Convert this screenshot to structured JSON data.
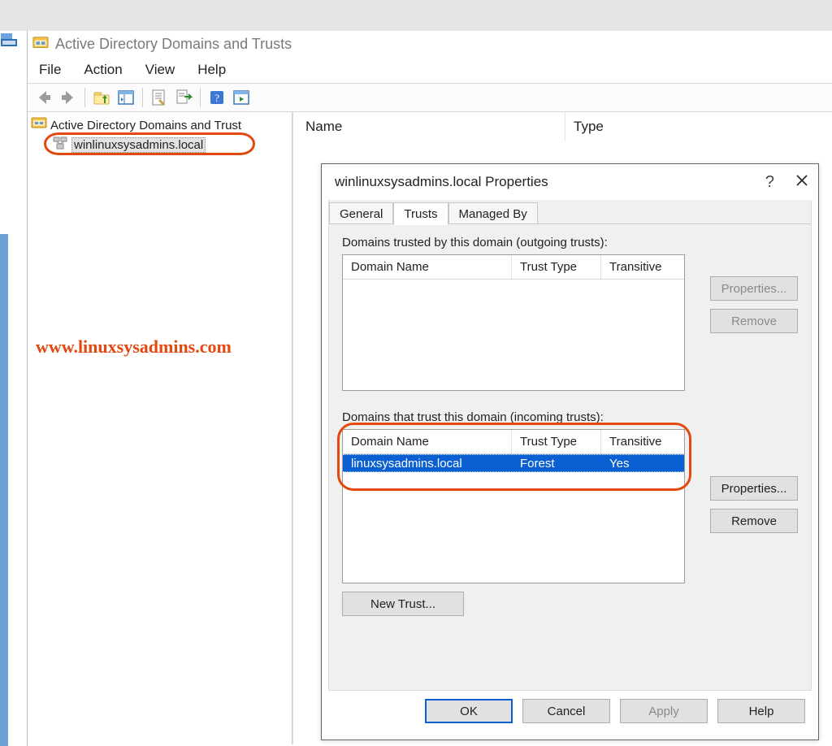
{
  "window": {
    "title": "Active Directory Domains and Trusts"
  },
  "menu": {
    "file": "File",
    "action": "Action",
    "view": "View",
    "help": "Help"
  },
  "tree": {
    "root": "Active Directory Domains and Trust",
    "child": "winlinuxsysadmins.local"
  },
  "list_headers": {
    "name": "Name",
    "type": "Type"
  },
  "watermark": "www.linuxsysadmins.com",
  "dialog": {
    "title": "winlinuxsysadmins.local Properties",
    "help_symbol": "?",
    "tabs": {
      "general": "General",
      "trusts": "Trusts",
      "managed_by": "Managed By"
    },
    "outgoing_label": "Domains trusted by this domain (outgoing trusts):",
    "incoming_label": "Domains that trust this domain (incoming trusts):",
    "table_headers": {
      "domain": "Domain Name",
      "trust_type": "Trust Type",
      "transitive": "Transitive"
    },
    "incoming_rows": [
      {
        "domain": "linuxsysadmins.local",
        "trust_type": "Forest",
        "transitive": "Yes"
      }
    ],
    "buttons": {
      "properties": "Properties...",
      "remove": "Remove",
      "new_trust": "New Trust...",
      "ok": "OK",
      "cancel": "Cancel",
      "apply": "Apply",
      "help": "Help"
    }
  }
}
